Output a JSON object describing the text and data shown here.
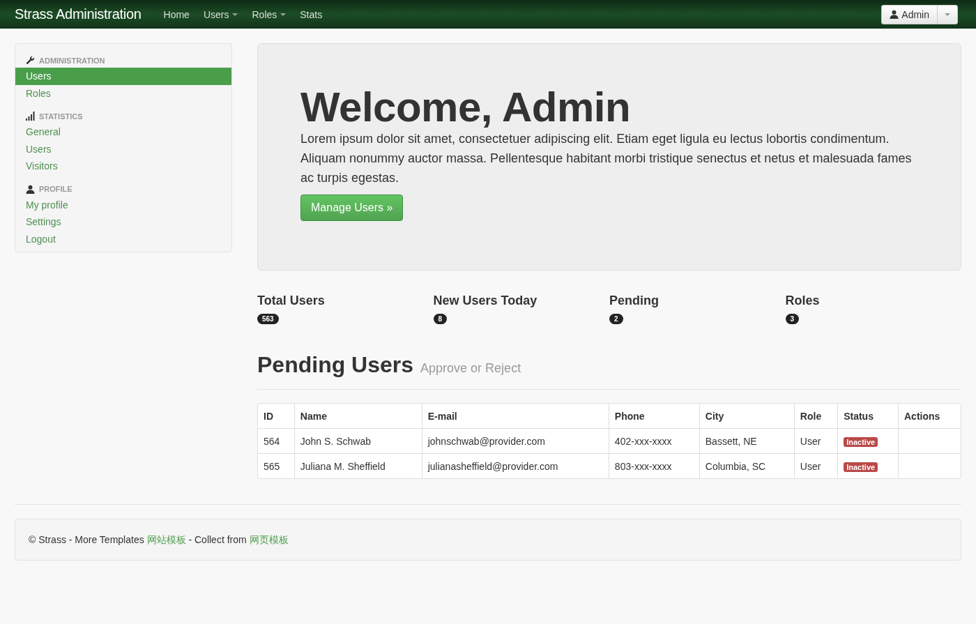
{
  "navbar": {
    "brand": "Strass Administration",
    "items": [
      {
        "label": "Home",
        "kind": "link"
      },
      {
        "label": "Users",
        "kind": "dropdown"
      },
      {
        "label": "Roles",
        "kind": "dropdown"
      },
      {
        "label": "Stats",
        "kind": "link"
      }
    ],
    "user": {
      "label": "Admin"
    }
  },
  "sidebar": {
    "sections": [
      {
        "header": "ADMINISTRATION",
        "kind": "admin",
        "items": [
          {
            "label": "Users",
            "selected": true
          },
          {
            "label": "Roles",
            "selected": false
          }
        ]
      },
      {
        "header": "STATISTICS",
        "kind": "stats",
        "items": [
          {
            "label": "General",
            "selected": false
          },
          {
            "label": "Users",
            "selected": false
          },
          {
            "label": "Visitors",
            "selected": false
          }
        ]
      },
      {
        "header": "PROFILE",
        "kind": "profile",
        "items": [
          {
            "label": "My profile",
            "selected": false
          },
          {
            "label": "Settings",
            "selected": false
          },
          {
            "label": "Logout",
            "selected": false
          }
        ]
      }
    ]
  },
  "hero": {
    "title": "Welcome, Admin",
    "text": "Lorem ipsum dolor sit amet, consectetuer adipiscing elit. Etiam eget ligula eu lectus lobortis condimentum. Aliquam nonummy auctor massa. Pellentesque habitant morbi tristique senectus et netus et malesuada fames ac turpis egestas.",
    "button": "Manage Users »"
  },
  "stats": [
    {
      "label": "Total Users",
      "count": "563"
    },
    {
      "label": "New Users Today",
      "count": "8"
    },
    {
      "label": "Pending",
      "count": "2"
    },
    {
      "label": "Roles",
      "count": "3"
    }
  ],
  "pending": {
    "title": "Pending Users",
    "subtitle": "Approve or Reject",
    "columns": [
      "ID",
      "Name",
      "E-mail",
      "Phone",
      "City",
      "Role",
      "Status",
      "Actions"
    ],
    "rows": [
      {
        "id": "564",
        "name": "John S. Schwab",
        "email": "johnschwab@provider.com",
        "phone": "402-xxx-xxxx",
        "city": "Bassett, NE",
        "role": "User",
        "status": "Inactive"
      },
      {
        "id": "565",
        "name": "Juliana M. Sheffield",
        "email": "julianasheffield@provider.com",
        "phone": "803-xxx-xxxx",
        "city": "Columbia, SC",
        "role": "User",
        "status": "Inactive"
      }
    ]
  },
  "footer": {
    "parts": [
      {
        "kind": "text",
        "text": "© Strass - More Templates "
      },
      {
        "kind": "link",
        "text": "网站模板"
      },
      {
        "kind": "text",
        "text": " - Collect from "
      },
      {
        "kind": "link",
        "text": "网页模板"
      }
    ]
  }
}
